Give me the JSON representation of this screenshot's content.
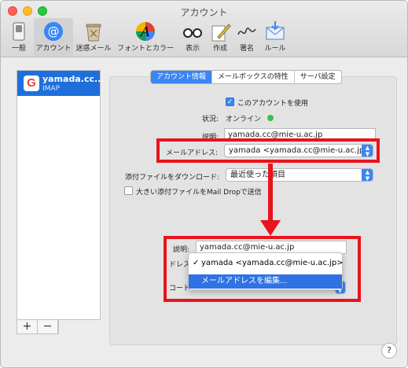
{
  "window": {
    "title": "アカウント"
  },
  "toolbar": [
    {
      "label": "一般",
      "icon": "switch-icon"
    },
    {
      "label": "アカウント",
      "icon": "at-sign-icon"
    },
    {
      "label": "迷惑メール",
      "icon": "junk-trash-icon"
    },
    {
      "label": "フォントとカラー",
      "icon": "color-wheel-icon"
    },
    {
      "label": "表示",
      "icon": "glasses-icon"
    },
    {
      "label": "作成",
      "icon": "pencil-paper-icon"
    },
    {
      "label": "署名",
      "icon": "signature-icon"
    },
    {
      "label": "ルール",
      "icon": "rules-envelope-icon"
    }
  ],
  "sidebar": {
    "account_name": "yamada.cc...",
    "account_type": "IMAP",
    "add_label": "+",
    "remove_label": "−"
  },
  "tabs": [
    "アカウント情報",
    "メールボックスの特性",
    "サーバ設定"
  ],
  "form": {
    "enable_label": "このアカウントを使用",
    "status_label": "状況:",
    "status_value": "オンライン",
    "desc_label": "説明:",
    "desc_value": "yamada.cc@mie-u.ac.jp",
    "email_label": "メールアドレス:",
    "email_value": "yamada <yamada.cc@mie-u.ac.jp>",
    "attach_label": "添付ファイルをダウンロード:",
    "attach_value": "最近使った項目",
    "maildrop_label": "大きい添付ファイルをMail Dropで送信"
  },
  "zoom": {
    "desc_label": "説明:",
    "desc_value": "yamada.cc@mie-u.ac.jp",
    "addr_partial": "ドレス",
    "code_partial": "コード",
    "menu_selected": "yamada <yamada.cc@mie-u.ac.jp>",
    "menu_check": "✓",
    "menu_edit": "メールアドレスを編集..."
  },
  "help_label": "?",
  "colors": {
    "accent": "#3a86f4",
    "highlight_red": "#e8141b",
    "online": "#3cc04a",
    "selection": "#1e6fdc"
  }
}
